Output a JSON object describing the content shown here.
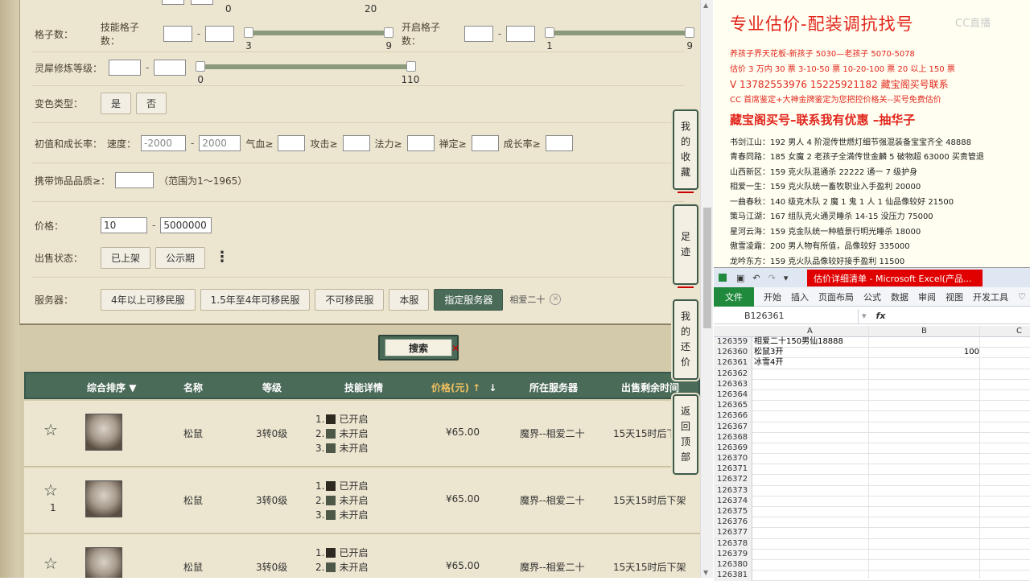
{
  "filters": {
    "top_slider_ticks": [
      "0",
      "20"
    ],
    "grid_count": {
      "label": "格子数：",
      "skill_label": "技能格子数：",
      "skill_ticks": [
        "3",
        "9"
      ],
      "open_label": "开启格子数：",
      "open_ticks": [
        "1",
        "9"
      ]
    },
    "spirit_level": {
      "label": "灵犀修炼等级：",
      "ticks": [
        "0",
        "110"
      ]
    },
    "color_type": {
      "label": "变色类型：",
      "yes": "是",
      "no": "否"
    },
    "initial": {
      "label": "初值和成长率：",
      "speed_label": "速度：",
      "speed_min": "-2000",
      "speed_max": "2000",
      "hp_label": "气血≥",
      "atk_label": "攻击≥",
      "mag_label": "法力≥",
      "seal_label": "禅定≥",
      "growth_label": "成长率≥"
    },
    "accessory": {
      "label": "携带饰品品质≥：",
      "hint": "（范围为1～1965）"
    },
    "price": {
      "label": "价格：",
      "min": "10",
      "max": "5000000"
    },
    "sale_status": {
      "label": "出售状态：",
      "listed": "已上架",
      "preview": "公示期",
      "more": "⋮"
    },
    "server": {
      "label": "服务器：",
      "options": [
        "4年以上可移民服",
        "1.5年至4年可移民服",
        "不可移民服",
        "本服",
        "指定服务器"
      ],
      "selected_tag": "相爱二十"
    }
  },
  "search_button": "搜索",
  "table": {
    "headers": {
      "sort": "综合排序",
      "name": "名称",
      "level": "等级",
      "skills": "技能详情",
      "price": "价格(元)",
      "server": "所在服务器",
      "time": "出售剩余时间"
    },
    "rows": [
      {
        "fav_count": "",
        "name": "松鼠",
        "level": "3转0级",
        "skills": [
          "1.",
          "已开启",
          "2.",
          "未开启",
          "3.",
          "未开启"
        ],
        "price": "¥65.00",
        "server": "魔界--相爱二十",
        "time": "15天15时后下架"
      },
      {
        "fav_count": "1",
        "name": "松鼠",
        "level": "3转0级",
        "skills": [
          "1.",
          "已开启",
          "2.",
          "未开启",
          "3.",
          "未开启"
        ],
        "price": "¥65.00",
        "server": "魔界--相爱二十",
        "time": "15天15时后下架"
      },
      {
        "fav_count": "",
        "name": "松鼠",
        "level": "3转0级",
        "skills": [
          "1.",
          "已开启",
          "2.",
          "未开启"
        ],
        "price": "¥65.00",
        "server": "魔界--相爱二十",
        "time": "15天15时后下架"
      }
    ]
  },
  "side_buttons": {
    "collect": [
      "我",
      "的",
      "收",
      "藏"
    ],
    "footprint": [
      "足",
      "迹"
    ],
    "bargain": [
      "我",
      "的",
      "还",
      "价"
    ],
    "top": [
      "返",
      "回",
      "顶",
      "部"
    ]
  },
  "ad": {
    "title": "专业估价-配装调抗找号",
    "watermark": "CC直播",
    "line1": "养孩子界天花板-新孩子 5030—老孩子 5070-5078",
    "line2": "估价 3 万内 30 票   3-10-50 票   10-20-100 票   20 以上 150 票",
    "line3": "V 13782553976    15225921182   藏宝阁买号联系",
    "line4": "CC 首席鉴定+大神金牌鉴定为您把控价格关--买号免费估价",
    "subtitle": "藏宝阁买号–联系我有优惠 –抽华子",
    "items": [
      "书剑江山：192 男人 4 阶混传世燃灯细节强混装备宝宝齐全 48888",
      "青春同路：185 女魔 2 老孩子全満传世金麟 5 破物超 63000 买贵管退",
      "山西新区：159 克火队混通杀 22222 通一 7 级护身",
      "相爱一生：159 克火队统一畜牧职业入手盈利 20000",
      "一曲春秋：140 级克木队 2 魔 1 鬼 1 人 1 仙品像较好 21500",
      "策马江湖：167 组队克火通灵睡杀 14-15 没压力 75000",
      "星河云海：159 克金队统一种植景行明光睡杀 18000",
      "傲雪凌霜：200 男人物有所值，品像较好 335000",
      "龙吟东方：159 克火队品像较好接手盈利 11500"
    ]
  },
  "excel": {
    "title": "估价详细清单 - Microsoft Excel(产品...",
    "tabs": [
      "文件",
      "开始",
      "插入",
      "页面布局",
      "公式",
      "数据",
      "审阅",
      "视图",
      "开发工具"
    ],
    "name_box": "B126361",
    "fx": "fx",
    "col_a": "A",
    "col_b": "B",
    "col_c": "C",
    "rows": [
      {
        "n": "126359",
        "a": "相爱二十150男仙18888",
        "b": ""
      },
      {
        "n": "126360",
        "a": "松鼠3开",
        "b": "100"
      },
      {
        "n": "126361",
        "a": "冰雪4开",
        "b": ""
      },
      {
        "n": "126362",
        "a": "",
        "b": ""
      },
      {
        "n": "126363",
        "a": "",
        "b": ""
      },
      {
        "n": "126364",
        "a": "",
        "b": ""
      },
      {
        "n": "126365",
        "a": "",
        "b": ""
      },
      {
        "n": "126366",
        "a": "",
        "b": ""
      },
      {
        "n": "126367",
        "a": "",
        "b": ""
      },
      {
        "n": "126368",
        "a": "",
        "b": ""
      },
      {
        "n": "126369",
        "a": "",
        "b": ""
      },
      {
        "n": "126370",
        "a": "",
        "b": ""
      },
      {
        "n": "126371",
        "a": "",
        "b": ""
      },
      {
        "n": "126372",
        "a": "",
        "b": ""
      },
      {
        "n": "126373",
        "a": "",
        "b": ""
      },
      {
        "n": "126374",
        "a": "",
        "b": ""
      },
      {
        "n": "126375",
        "a": "",
        "b": ""
      },
      {
        "n": "126376",
        "a": "",
        "b": ""
      },
      {
        "n": "126377",
        "a": "",
        "b": ""
      },
      {
        "n": "126378",
        "a": "",
        "b": ""
      },
      {
        "n": "126379",
        "a": "",
        "b": ""
      },
      {
        "n": "126380",
        "a": "",
        "b": ""
      },
      {
        "n": "126381",
        "a": "",
        "b": ""
      }
    ]
  },
  "colors": {
    "accent_green": "#4b6b59",
    "ad_red": "#e2261d",
    "excel_green": "#1f8a3c"
  }
}
